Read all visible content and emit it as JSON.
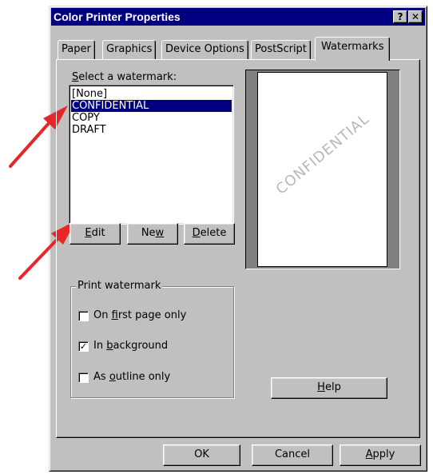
{
  "window": {
    "title": "Color Printer Properties"
  },
  "titlebar_buttons": {
    "help": "?",
    "close": "✕"
  },
  "tabs": [
    {
      "label": "Paper"
    },
    {
      "label": "Graphics"
    },
    {
      "label": "Device Options"
    },
    {
      "label": "PostScript"
    },
    {
      "label": "Watermarks",
      "active": true
    }
  ],
  "watermarks": {
    "select_label_accel": "S",
    "select_label_rest": "elect a watermark:",
    "items": [
      "[None]",
      "CONFIDENTIAL",
      "COPY",
      "DRAFT"
    ],
    "selected_index": 1,
    "preview_text": "CONFIDENTIAL"
  },
  "buttons": {
    "edit_accel": "E",
    "edit_rest": "dit",
    "new_pre": "Ne",
    "new_accel": "w",
    "delete_accel": "D",
    "delete_rest": "elete",
    "help_accel": "H",
    "help_rest": "elp"
  },
  "print_watermark": {
    "title": "Print watermark",
    "first_page": {
      "pre": "On ",
      "accel": "f",
      "rest": "irst page only",
      "checked": false
    },
    "background": {
      "pre": "In ",
      "accel": "b",
      "rest": "ackground",
      "checked": true
    },
    "outline": {
      "pre": "As ",
      "accel": "o",
      "rest": "utline only",
      "checked": false
    }
  },
  "footer": {
    "ok": "OK",
    "cancel": "Cancel",
    "apply_accel": "A",
    "apply_rest": "pply"
  },
  "colors": {
    "titlebar": "#000080",
    "face": "#c0c0c0",
    "arrow": "#e8262a"
  }
}
